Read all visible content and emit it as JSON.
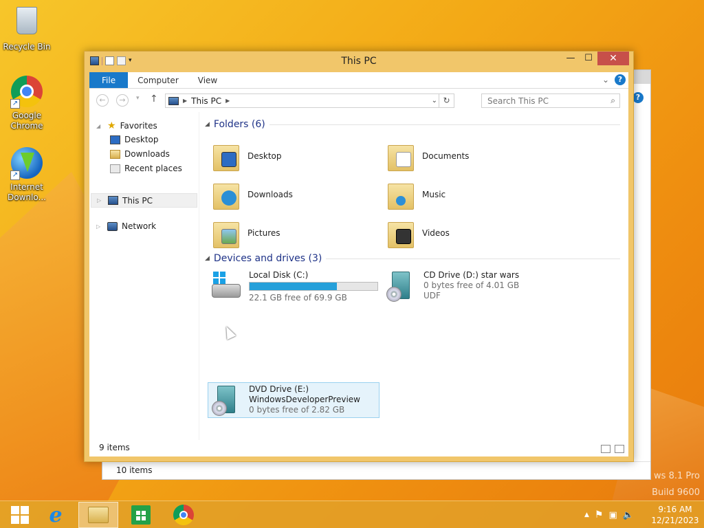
{
  "desktop": {
    "icons": [
      {
        "label": "Recycle Bin",
        "icon": "recycle-bin-icon"
      },
      {
        "label": "Google Chrome",
        "icon": "chrome-icon"
      },
      {
        "label": "Internet Downlo...",
        "icon": "internet-download-manager-icon"
      }
    ],
    "watermark_line1": "ws 8.1 Pro",
    "watermark_line2": "Build 9600"
  },
  "background_window": {
    "status": "10 items"
  },
  "window": {
    "title": "This PC",
    "ribbon_tabs": [
      "File",
      "Computer",
      "View"
    ],
    "address": {
      "location": "This PC"
    },
    "search": {
      "placeholder": "Search This PC"
    },
    "nav": {
      "favorites": "Favorites",
      "favorite_items": [
        "Desktop",
        "Downloads",
        "Recent places"
      ],
      "this_pc": "This PC",
      "network": "Network"
    },
    "folders_header": "Folders (6)",
    "folders": [
      "Desktop",
      "Documents",
      "Downloads",
      "Music",
      "Pictures",
      "Videos"
    ],
    "devices_header": "Devices and drives (3)",
    "drives": [
      {
        "name": "Local Disk (C:)",
        "free": "22.1 GB free of 69.9 GB",
        "used_fraction": 0.684
      },
      {
        "name": "CD Drive (D:) star wars",
        "free": "0 bytes free of 4.01 GB",
        "fs": "UDF"
      },
      {
        "name": "DVD Drive (E:)",
        "label": "WindowsDeveloperPreview",
        "free": "0 bytes free of 2.82 GB"
      }
    ],
    "status": "9 items"
  },
  "taskbar": {
    "clock_time": "9:16 AM",
    "clock_date": "12/21/2023"
  },
  "colors": {
    "accent": "#1979ca",
    "title_bar": "#f1c66a",
    "progress": "#26a0da",
    "selection": "#e5f3fb",
    "close_button": "#c7504a"
  }
}
